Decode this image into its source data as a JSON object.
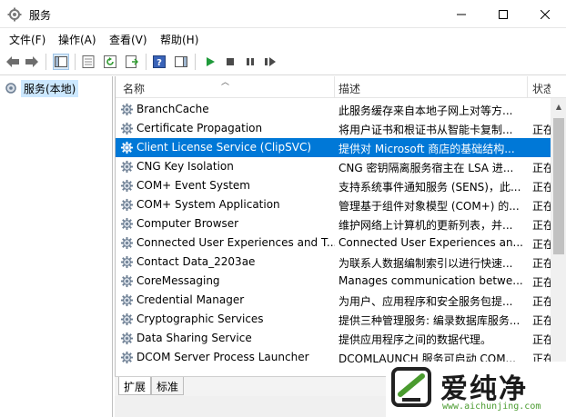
{
  "window": {
    "title": "服务"
  },
  "menu": [
    "文件(F)",
    "操作(A)",
    "查看(V)",
    "帮助(H)"
  ],
  "tree": {
    "root": "服务(本地)"
  },
  "columns": {
    "name": "名称",
    "description": "描述",
    "status": "状态"
  },
  "services": [
    {
      "name": "BranchCache",
      "description": "此服务缓存来自本地子网上对等方...",
      "status": ""
    },
    {
      "name": "Certificate Propagation",
      "description": "将用户证书和根证书从智能卡复制...",
      "status": "正在"
    },
    {
      "name": "Client License Service (ClipSVC)",
      "description": "提供对 Microsoft 商店的基础结构...",
      "status": "",
      "selected": true
    },
    {
      "name": "CNG Key Isolation",
      "description": "CNG 密钥隔离服务宿主在 LSA 进...",
      "status": "正在"
    },
    {
      "name": "COM+ Event System",
      "description": "支持系统事件通知服务 (SENS)，此...",
      "status": "正在"
    },
    {
      "name": "COM+ System Application",
      "description": "管理基于组件对象模型 (COM+) 的...",
      "status": "正在"
    },
    {
      "name": "Computer Browser",
      "description": "维护网络上计算机的更新列表，并...",
      "status": "正在"
    },
    {
      "name": "Connected User Experiences and T...",
      "description": "Connected User Experiences an...",
      "status": "正在"
    },
    {
      "name": "Contact Data_2203ae",
      "description": "为联系人数据编制索引以进行快速...",
      "status": "正在"
    },
    {
      "name": "CoreMessaging",
      "description": "Manages communication betwe...",
      "status": "正在"
    },
    {
      "name": "Credential Manager",
      "description": "为用户、应用程序和安全服务包提...",
      "status": "正在"
    },
    {
      "name": "Cryptographic Services",
      "description": "提供三种管理服务: 编录数据库服务...",
      "status": "正在"
    },
    {
      "name": "Data Sharing Service",
      "description": "提供应用程序之间的数据代理。",
      "status": "正在"
    },
    {
      "name": "DCOM Server Process Launcher",
      "description": "DCOMLAUNCH 服务可启动 COM...",
      "status": "正在"
    }
  ],
  "tabs": [
    "扩展",
    "标准"
  ],
  "watermark": {
    "text": "爱纯净",
    "url": "www.aichunjing.com"
  },
  "colors": {
    "selection": "#0078d7",
    "accent_green": "#4a9b2f",
    "tree_selection": "#cce8ff"
  }
}
